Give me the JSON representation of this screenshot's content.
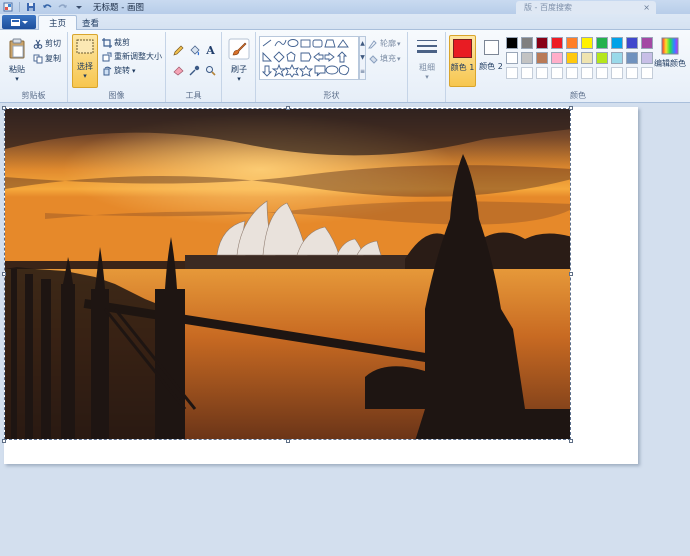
{
  "window": {
    "title": "无标题 - 画图",
    "browser_tab_title": "版 - 百度搜索",
    "colors": {
      "ribbon_bg": "#eef3fa",
      "file_button": "#2a62b3",
      "selected_tool": "#fbd36b"
    }
  },
  "tabs": [
    {
      "label": "主页",
      "active": true
    },
    {
      "label": "查看",
      "active": false
    }
  ],
  "ribbon": {
    "clipboard": {
      "label": "剪贴板",
      "paste": "粘贴",
      "cut": "剪切",
      "copy": "复制"
    },
    "image": {
      "label": "图像",
      "select": "选择",
      "crop": "裁剪",
      "resize": "重新调整大小",
      "rotate": "旋转"
    },
    "tools": {
      "label": "工具"
    },
    "brushes": {
      "label": "刷子"
    },
    "shapes": {
      "label": "形状",
      "outline": "轮廓",
      "fill": "填充"
    },
    "size": {
      "label": "粗细"
    },
    "colors": {
      "label": "颜色",
      "color1": "颜色 1",
      "color2": "颜色 2",
      "edit_colors": "编辑颜色",
      "color1_value": "#e81c23",
      "color2_value": "#ffffff",
      "palette_row1": [
        "#000000",
        "#7f7f7f",
        "#880015",
        "#ed1c24",
        "#ff7f27",
        "#fff200",
        "#22b14c",
        "#00a2e8",
        "#3f48cc",
        "#a349a4"
      ],
      "palette_row2": [
        "#ffffff",
        "#c3c3c3",
        "#b97a57",
        "#ffaec9",
        "#ffc90e",
        "#efe4b0",
        "#b5e61d",
        "#99d9ea",
        "#7092be",
        "#c8bfe7"
      ]
    }
  },
  "canvas": {
    "image_description_icon": "sydney-opera-house-sunset-photo"
  }
}
